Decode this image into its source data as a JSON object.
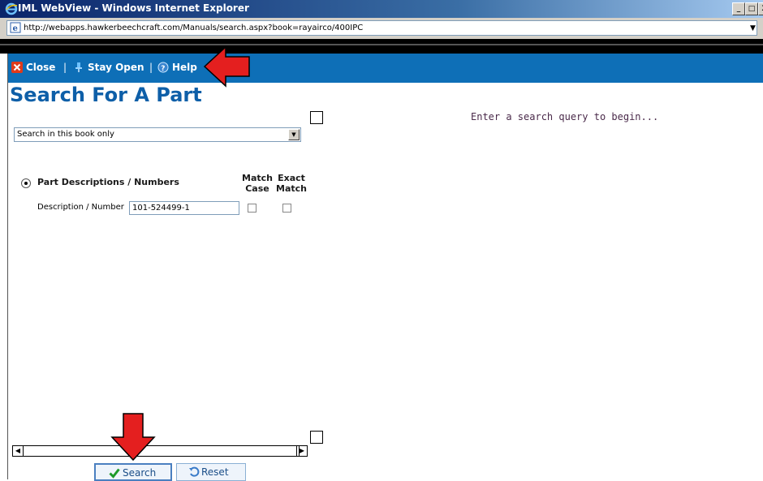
{
  "window": {
    "title": "IML WebView - Windows Internet Explorer",
    "minimize_glyph": "_",
    "maximize_glyph": "□",
    "close_glyph": "X"
  },
  "address_bar": {
    "url": "http://webapps.hawkerbeechcraft.com/Manuals/search.aspx?book=rayairco/400IPC"
  },
  "toolbar": {
    "close_label": "Close",
    "separator": "|",
    "stay_open_label": "Stay Open",
    "help_label": "Help"
  },
  "page": {
    "title": "Search For A Part",
    "scope_select": {
      "selected": "Search in this book only"
    },
    "results_message": "Enter a search query to begin...",
    "search_mode": {
      "label": "Part Descriptions / Numbers",
      "selected": true
    },
    "columns": {
      "match_case_line1": "Match",
      "match_case_line2": "Case",
      "exact_match_line1": "Exact",
      "exact_match_line2": "Match"
    },
    "field": {
      "label": "Description / Number",
      "value": "101-524499-1",
      "match_case_checked": false,
      "exact_match_checked": false
    },
    "buttons": {
      "search_label": "Search",
      "reset_label": "Reset"
    }
  },
  "colors": {
    "toolbar_bg": "#0e6fb7",
    "heading": "#0e5fa8",
    "annotation_arrow": "#e41f1f",
    "results_text": "#4a2a4a"
  },
  "icons": [
    "ie-logo-icon",
    "page-icon",
    "close-icon",
    "pin-icon",
    "help-icon",
    "checkmark-icon",
    "reset-icon",
    "dropdown-arrow-icon"
  ]
}
